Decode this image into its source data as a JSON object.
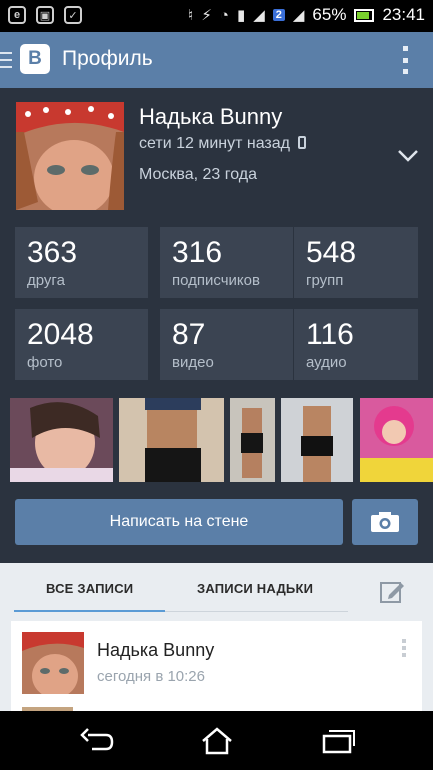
{
  "status_bar": {
    "icons": [
      "e-icon",
      "image-icon",
      "bag-icon"
    ],
    "sim2_label": "2",
    "battery": "65%",
    "time": "23:41"
  },
  "app_bar": {
    "logo_letter": "B",
    "title": "Профиль"
  },
  "profile": {
    "name": "Надька Bunny",
    "online": "сети 12 минут назад",
    "city_age": "Москва, 23 года"
  },
  "stats": [
    {
      "num": "363",
      "label": "друга"
    },
    {
      "num": "316",
      "label": "подписчиков"
    },
    {
      "num": "548",
      "label": "групп"
    },
    {
      "num": "2048",
      "label": "фото"
    },
    {
      "num": "87",
      "label": "видео"
    },
    {
      "num": "116",
      "label": "аудио"
    }
  ],
  "actions": {
    "wall_button": "Написать на стене"
  },
  "feed": {
    "tabs": [
      "ВСЕ ЗАПИСИ",
      "ЗАПИСИ НАДЬКИ"
    ],
    "post": {
      "author": "Надька Bunny",
      "time": "сегодня в 10:26"
    }
  },
  "colors": {
    "brand": "#5b7fa8",
    "profile_bg": "#2b333f",
    "stat_bg": "#3b4452",
    "tab_active_line": "#5b9bd5"
  }
}
